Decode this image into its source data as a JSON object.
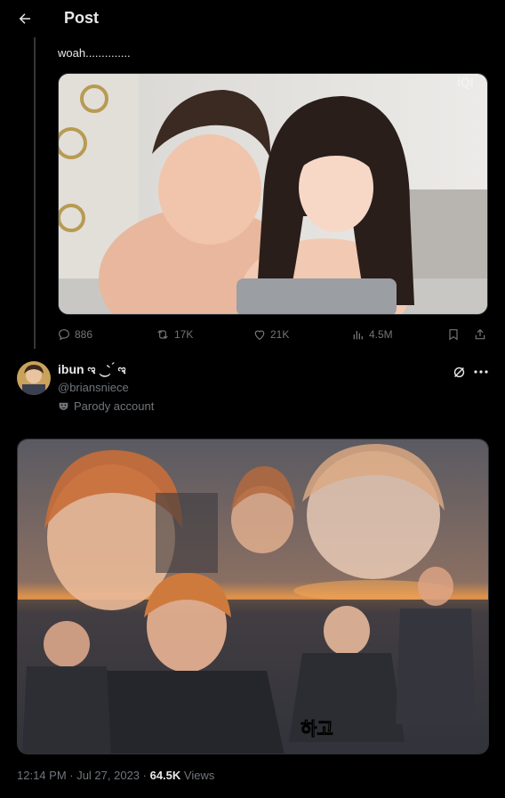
{
  "header": {
    "title": "Post",
    "back_icon": "arrow-left-icon"
  },
  "quoted_reply": {
    "text": "woah..............",
    "actions": {
      "replies": "886",
      "reposts": "17K",
      "likes": "21K",
      "views": "4.5M"
    }
  },
  "post": {
    "author_name": "ibun ಇ ‿̀ ́ ಇ",
    "author_handle": "@briansniece",
    "parody_label": "Parody account",
    "timestamp": "12:14 PM · Jul 27, 2023 · ",
    "views_count": "64.5K",
    "views_label": " Views"
  },
  "watermark": "iQI",
  "overlay_caption": "하고",
  "colors": {
    "background": "#000000",
    "text": "#e7e9ea",
    "muted": "#71767b",
    "border": "#2f3336"
  }
}
